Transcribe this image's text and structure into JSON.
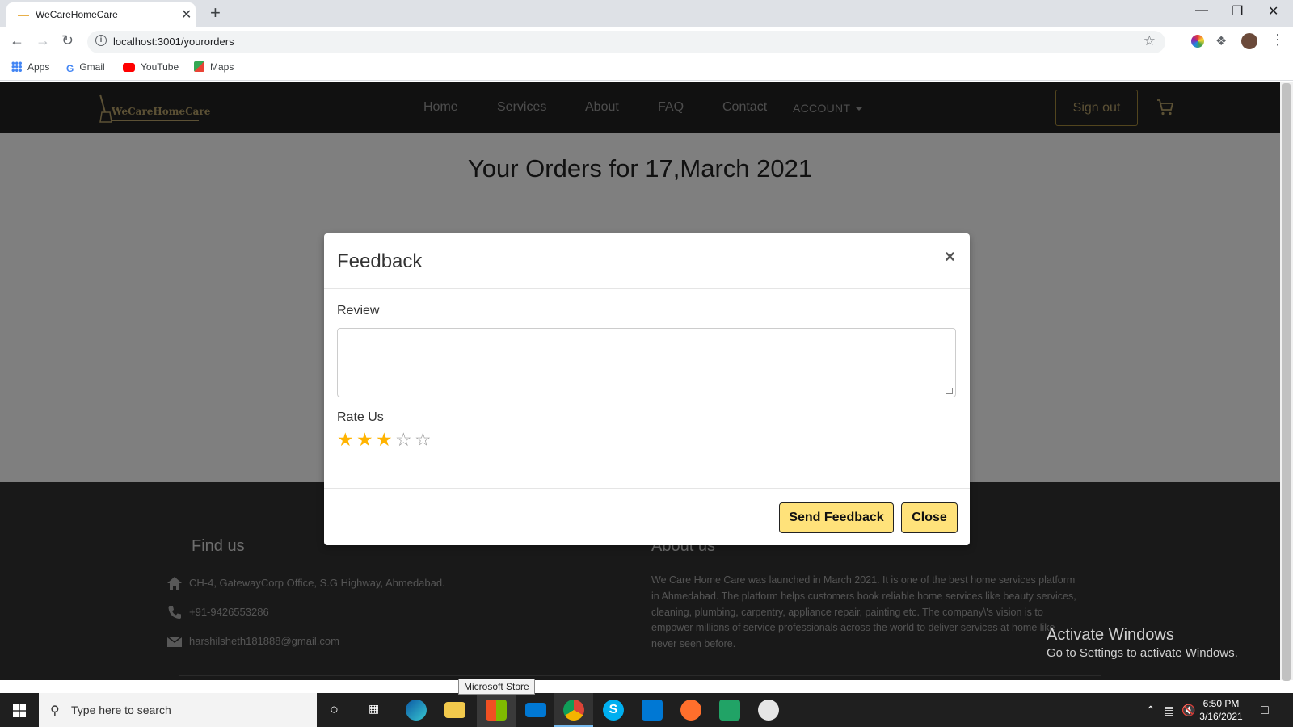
{
  "browser": {
    "tab_title": "WeCareHomeCare",
    "tab_close": "✕",
    "new_tab": "+",
    "url": "localhost:3001/yourorders",
    "bookmarks": [
      "Apps",
      "Gmail",
      "YouTube",
      "Maps"
    ]
  },
  "site": {
    "logo_text": "WeCareHomeCare",
    "nav": [
      "Home",
      "Services",
      "About",
      "FAQ",
      "Contact"
    ],
    "account_label": "ACCOUNT",
    "signout_label": "Sign out",
    "orders_title": "Your Orders for 17,March 2021"
  },
  "modal": {
    "title": "Feedback",
    "close_x": "×",
    "review_label": "Review",
    "review_value": "",
    "rate_label": "Rate Us",
    "rating": 3,
    "max_rating": 5,
    "send_label": "Send Feedback",
    "close_label": "Close"
  },
  "footer": {
    "find_us_title": "Find us",
    "address": "CH-4, GatewayCorp Office, S.G Highway, Ahmedabad.",
    "phone": "+91-9426553286",
    "email": "harshilsheth181888@gmail.com",
    "about_title": "About us",
    "about_text": "We Care Home Care was launched in March 2021. It is one of the best home services platform in Ahmedabad. The platform helps customers book reliable home services like beauty services, cleaning, plumbing, carpentry, appliance repair, painting etc. The company\\'s vision is to empower millions of service professionals across the world to deliver services at home like never seen before."
  },
  "windows": {
    "activate_title": "Activate Windows",
    "activate_sub": "Go to Settings to activate Windows.",
    "search_placeholder": "Type here to search",
    "tooltip": "Microsoft Store",
    "time": "6:50 PM",
    "date": "3/16/2021"
  },
  "colors": {
    "nav_bg": "#222222",
    "button_yellow": "#ffe27a",
    "star_gold": "#ffb300",
    "gold_accent": "#b8a36b"
  }
}
